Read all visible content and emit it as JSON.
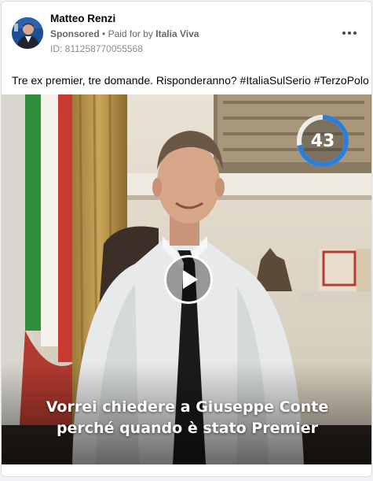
{
  "post": {
    "author": "Matteo Renzi",
    "sponsored_label": "Sponsored",
    "paid_for_prefix": "Paid for by",
    "advertiser": "Italia Viva",
    "ad_id": "ID: 811258770055568",
    "text": "Tre ex premier, tre domande. Risponderanno? #ItaliaSulSerio #TerzoPolo"
  },
  "video": {
    "countdown": "43",
    "countdown_progress": 0.72,
    "subtitle_line1": "Vorrei chiedere a Giuseppe Conte",
    "subtitle_line2": "perché quando è stato Premier",
    "accent_color": "#2b7fd9"
  },
  "icons": {
    "more": "more-options-icon",
    "play": "play-icon"
  }
}
